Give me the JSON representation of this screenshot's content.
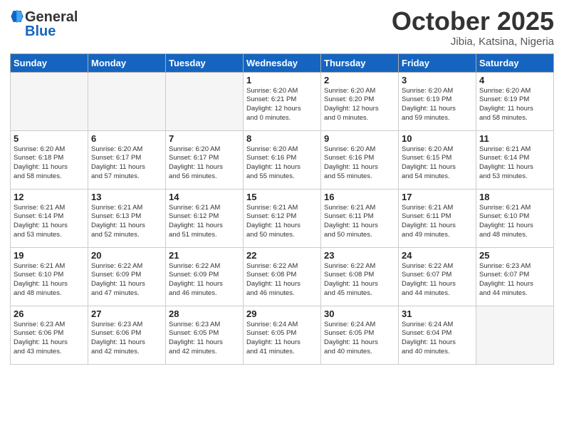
{
  "logo": {
    "general": "General",
    "blue": "Blue"
  },
  "header": {
    "month": "October 2025",
    "location": "Jibia, Katsina, Nigeria"
  },
  "weekdays": [
    "Sunday",
    "Monday",
    "Tuesday",
    "Wednesday",
    "Thursday",
    "Friday",
    "Saturday"
  ],
  "weeks": [
    [
      {
        "day": "",
        "info": ""
      },
      {
        "day": "",
        "info": ""
      },
      {
        "day": "",
        "info": ""
      },
      {
        "day": "1",
        "info": "Sunrise: 6:20 AM\nSunset: 6:21 PM\nDaylight: 12 hours\nand 0 minutes."
      },
      {
        "day": "2",
        "info": "Sunrise: 6:20 AM\nSunset: 6:20 PM\nDaylight: 12 hours\nand 0 minutes."
      },
      {
        "day": "3",
        "info": "Sunrise: 6:20 AM\nSunset: 6:19 PM\nDaylight: 11 hours\nand 59 minutes."
      },
      {
        "day": "4",
        "info": "Sunrise: 6:20 AM\nSunset: 6:19 PM\nDaylight: 11 hours\nand 58 minutes."
      }
    ],
    [
      {
        "day": "5",
        "info": "Sunrise: 6:20 AM\nSunset: 6:18 PM\nDaylight: 11 hours\nand 58 minutes."
      },
      {
        "day": "6",
        "info": "Sunrise: 6:20 AM\nSunset: 6:17 PM\nDaylight: 11 hours\nand 57 minutes."
      },
      {
        "day": "7",
        "info": "Sunrise: 6:20 AM\nSunset: 6:17 PM\nDaylight: 11 hours\nand 56 minutes."
      },
      {
        "day": "8",
        "info": "Sunrise: 6:20 AM\nSunset: 6:16 PM\nDaylight: 11 hours\nand 55 minutes."
      },
      {
        "day": "9",
        "info": "Sunrise: 6:20 AM\nSunset: 6:16 PM\nDaylight: 11 hours\nand 55 minutes."
      },
      {
        "day": "10",
        "info": "Sunrise: 6:20 AM\nSunset: 6:15 PM\nDaylight: 11 hours\nand 54 minutes."
      },
      {
        "day": "11",
        "info": "Sunrise: 6:21 AM\nSunset: 6:14 PM\nDaylight: 11 hours\nand 53 minutes."
      }
    ],
    [
      {
        "day": "12",
        "info": "Sunrise: 6:21 AM\nSunset: 6:14 PM\nDaylight: 11 hours\nand 53 minutes."
      },
      {
        "day": "13",
        "info": "Sunrise: 6:21 AM\nSunset: 6:13 PM\nDaylight: 11 hours\nand 52 minutes."
      },
      {
        "day": "14",
        "info": "Sunrise: 6:21 AM\nSunset: 6:12 PM\nDaylight: 11 hours\nand 51 minutes."
      },
      {
        "day": "15",
        "info": "Sunrise: 6:21 AM\nSunset: 6:12 PM\nDaylight: 11 hours\nand 50 minutes."
      },
      {
        "day": "16",
        "info": "Sunrise: 6:21 AM\nSunset: 6:11 PM\nDaylight: 11 hours\nand 50 minutes."
      },
      {
        "day": "17",
        "info": "Sunrise: 6:21 AM\nSunset: 6:11 PM\nDaylight: 11 hours\nand 49 minutes."
      },
      {
        "day": "18",
        "info": "Sunrise: 6:21 AM\nSunset: 6:10 PM\nDaylight: 11 hours\nand 48 minutes."
      }
    ],
    [
      {
        "day": "19",
        "info": "Sunrise: 6:21 AM\nSunset: 6:10 PM\nDaylight: 11 hours\nand 48 minutes."
      },
      {
        "day": "20",
        "info": "Sunrise: 6:22 AM\nSunset: 6:09 PM\nDaylight: 11 hours\nand 47 minutes."
      },
      {
        "day": "21",
        "info": "Sunrise: 6:22 AM\nSunset: 6:09 PM\nDaylight: 11 hours\nand 46 minutes."
      },
      {
        "day": "22",
        "info": "Sunrise: 6:22 AM\nSunset: 6:08 PM\nDaylight: 11 hours\nand 46 minutes."
      },
      {
        "day": "23",
        "info": "Sunrise: 6:22 AM\nSunset: 6:08 PM\nDaylight: 11 hours\nand 45 minutes."
      },
      {
        "day": "24",
        "info": "Sunrise: 6:22 AM\nSunset: 6:07 PM\nDaylight: 11 hours\nand 44 minutes."
      },
      {
        "day": "25",
        "info": "Sunrise: 6:23 AM\nSunset: 6:07 PM\nDaylight: 11 hours\nand 44 minutes."
      }
    ],
    [
      {
        "day": "26",
        "info": "Sunrise: 6:23 AM\nSunset: 6:06 PM\nDaylight: 11 hours\nand 43 minutes."
      },
      {
        "day": "27",
        "info": "Sunrise: 6:23 AM\nSunset: 6:06 PM\nDaylight: 11 hours\nand 42 minutes."
      },
      {
        "day": "28",
        "info": "Sunrise: 6:23 AM\nSunset: 6:05 PM\nDaylight: 11 hours\nand 42 minutes."
      },
      {
        "day": "29",
        "info": "Sunrise: 6:24 AM\nSunset: 6:05 PM\nDaylight: 11 hours\nand 41 minutes."
      },
      {
        "day": "30",
        "info": "Sunrise: 6:24 AM\nSunset: 6:05 PM\nDaylight: 11 hours\nand 40 minutes."
      },
      {
        "day": "31",
        "info": "Sunrise: 6:24 AM\nSunset: 6:04 PM\nDaylight: 11 hours\nand 40 minutes."
      },
      {
        "day": "",
        "info": ""
      }
    ]
  ]
}
